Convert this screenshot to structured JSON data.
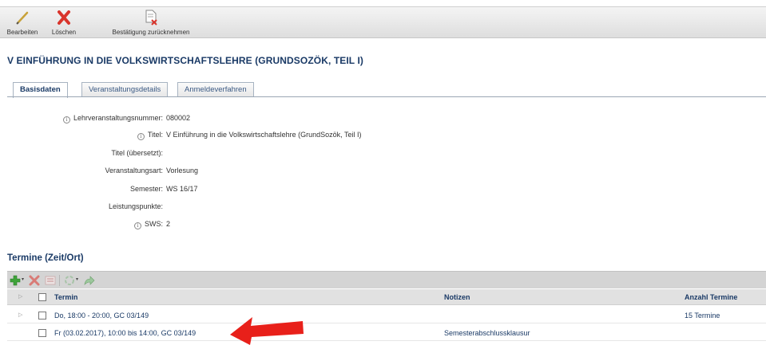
{
  "toolbar": {
    "edit_label": "Bearbeiten",
    "delete_label": "Löschen",
    "revoke_label": "Bestätigung zurücknehmen"
  },
  "page_title": "V EINFÜHRUNG IN DIE VOLKSWIRTSCHAFTSLEHRE (GRUNDSOZÖK, TEIL I)",
  "tabs": [
    {
      "label": "Basisdaten",
      "active": true
    },
    {
      "label": "Veranstaltungsdetails",
      "active": false
    },
    {
      "label": "Anmeldeverfahren",
      "active": false
    }
  ],
  "fields": {
    "lvnr": {
      "label": "Lehrveranstaltungsnummer:",
      "value": "080002"
    },
    "titel": {
      "label": "Titel:",
      "value": "V Einführung in die Volkswirtschaftslehre (GrundSozök, Teil I)"
    },
    "titel_uebersetzt": {
      "label": "Titel (übersetzt):",
      "value": ""
    },
    "art": {
      "label": "Veranstaltungsart:",
      "value": "Vorlesung"
    },
    "semester": {
      "label": "Semester:",
      "value": "WS 16/17"
    },
    "lp": {
      "label": "Leistungspunkte:",
      "value": ""
    },
    "sws": {
      "label": "SWS:",
      "value": "2"
    }
  },
  "termine": {
    "section_title": "Termine (Zeit/Ort)",
    "columns": {
      "termin": "Termin",
      "notizen": "Notizen",
      "anzahl": "Anzahl Termine"
    },
    "rows": [
      {
        "termin": "Do, 18:00 - 20:00, GC 03/149",
        "notizen": "",
        "anzahl": "15 Termine"
      },
      {
        "termin": "Fr (03.02.2017), 10:00 bis 14:00, GC 03/149",
        "notizen": "Semesterabschlussklausur",
        "anzahl": ""
      }
    ]
  },
  "colors": {
    "heading": "#1a3a66",
    "annotation_arrow": "#e8201a",
    "add_icon": "#3fa33a",
    "delete_icon": "#d9342b"
  }
}
